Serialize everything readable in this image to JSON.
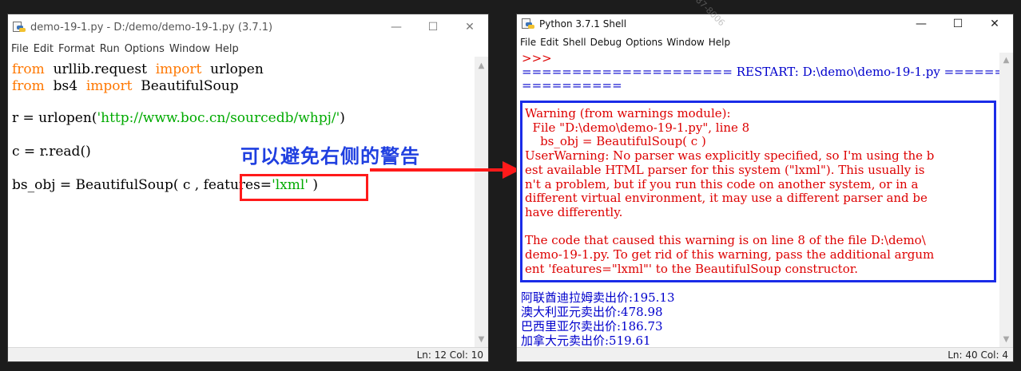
{
  "editor": {
    "title": "demo-19-1.py - D:/demo/demo-19-1.py (3.7.1)",
    "buttons": {
      "minimize": "—",
      "maximize": "☐",
      "close": "✕"
    },
    "menu": [
      "File",
      "Edit",
      "Format",
      "Run",
      "Options",
      "Window",
      "Help"
    ],
    "code": {
      "l1_kw1": "from",
      "l1_mod": "  urllib.request  ",
      "l1_kw2": "import",
      "l1_name": "  urlopen",
      "l2_kw1": "from",
      "l2_mod": "  bs4  ",
      "l2_kw2": "import",
      "l2_name": "  BeautifulSoup",
      "l3_pre": "r = urlopen(",
      "l3_str": "'http://www.boc.cn/sourcedb/whpj/'",
      "l3_post": ")",
      "l4": "c = r.read()",
      "l5_pre": "bs_obj = BeautifulSoup( c , ",
      "l5_feat": "features=",
      "l5_str": "'lxml'",
      "l5_post": " )"
    },
    "status": "Ln: 12  Col: 10"
  },
  "annotation": {
    "text": "可以避免右侧的警告",
    "highlight_color": "#ff1a1a",
    "text_color": "#1f3fe0"
  },
  "shell": {
    "title": "Python 3.7.1 Shell",
    "buttons": {
      "minimize": "—",
      "maximize": "☐",
      "close": "✕"
    },
    "menu": [
      "File",
      "Edit",
      "Shell",
      "Debug",
      "Options",
      "Window",
      "Help"
    ],
    "prompt": ">>>",
    "restart_line1": "===================== RESTART: D:\\demo\\demo-19-1.py ============",
    "restart_line2": "==========",
    "warning_lines": [
      "Warning (from warnings module):",
      "  File \"D:\\demo\\demo-19-1.py\", line 8",
      "    bs_obj = BeautifulSoup( c )",
      "UserWarning: No parser was explicitly specified, so I'm using the b",
      "est available HTML parser for this system (\"lxml\"). This usually is",
      "n't a problem, but if you run this code on another system, or in a",
      "different virtual environment, it may use a different parser and be",
      "have differently.",
      "",
      "The code that caused this warning is on line 8 of the file D:\\demo\\",
      "demo-19-1.py. To get rid of this warning, pass the additional argum",
      "ent 'features=\"lxml\"' to the BeautifulSoup constructor."
    ],
    "results": [
      "阿联酋迪拉姆卖出价:195.13",
      "澳大利亚元卖出价:478.98",
      "巴西里亚尔卖出价:186.73",
      "加拿大元卖出价:519.61"
    ],
    "status": "Ln: 40  Col: 4",
    "box_color": "#1a2ce8"
  },
  "watermark": "87-8006"
}
